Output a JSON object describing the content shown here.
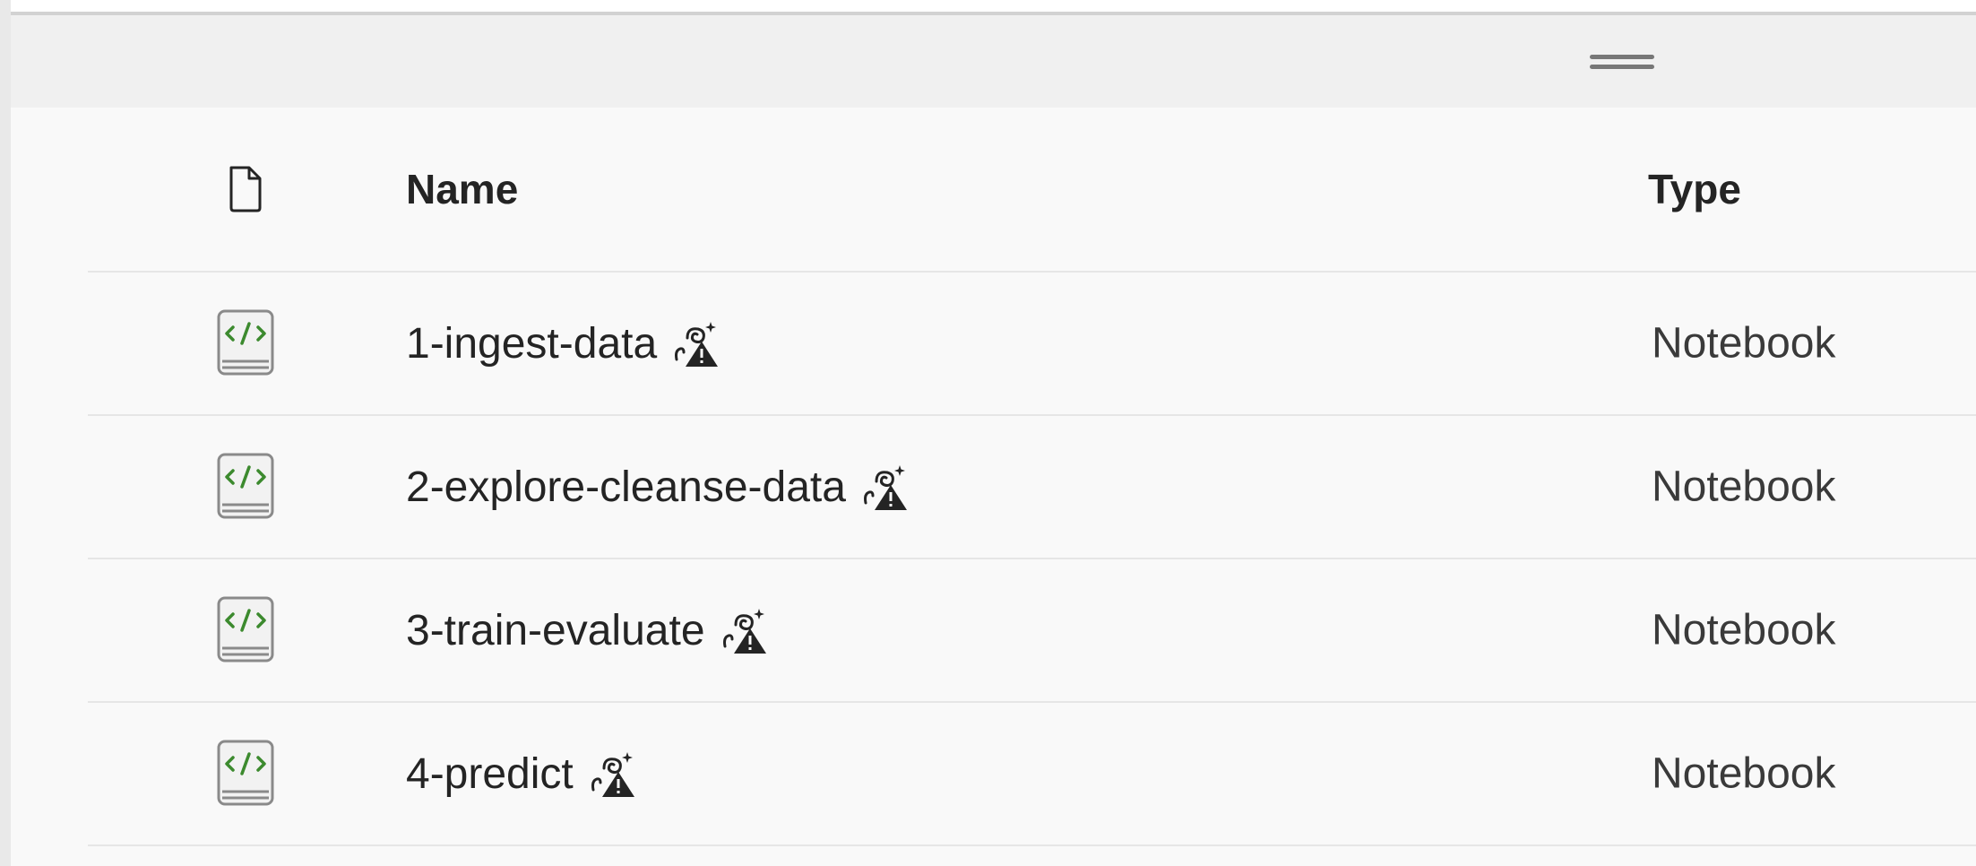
{
  "table": {
    "header": {
      "file_icon": "file-icon",
      "name_label": "Name",
      "type_label": "Type"
    },
    "rows": [
      {
        "name": "1-ingest-data",
        "type": "Notebook",
        "icon": "notebook-icon",
        "status_icon": "ml-warning-icon"
      },
      {
        "name": "2-explore-cleanse-data",
        "type": "Notebook",
        "icon": "notebook-icon",
        "status_icon": "ml-warning-icon"
      },
      {
        "name": "3-train-evaluate",
        "type": "Notebook",
        "icon": "notebook-icon",
        "status_icon": "ml-warning-icon"
      },
      {
        "name": "4-predict",
        "type": "Notebook",
        "icon": "notebook-icon",
        "status_icon": "ml-warning-icon"
      }
    ]
  },
  "colors": {
    "notebook_code_green": "#3c8a2e",
    "notebook_body": "#f2f2f2",
    "notebook_outline": "#8a8a8a"
  }
}
